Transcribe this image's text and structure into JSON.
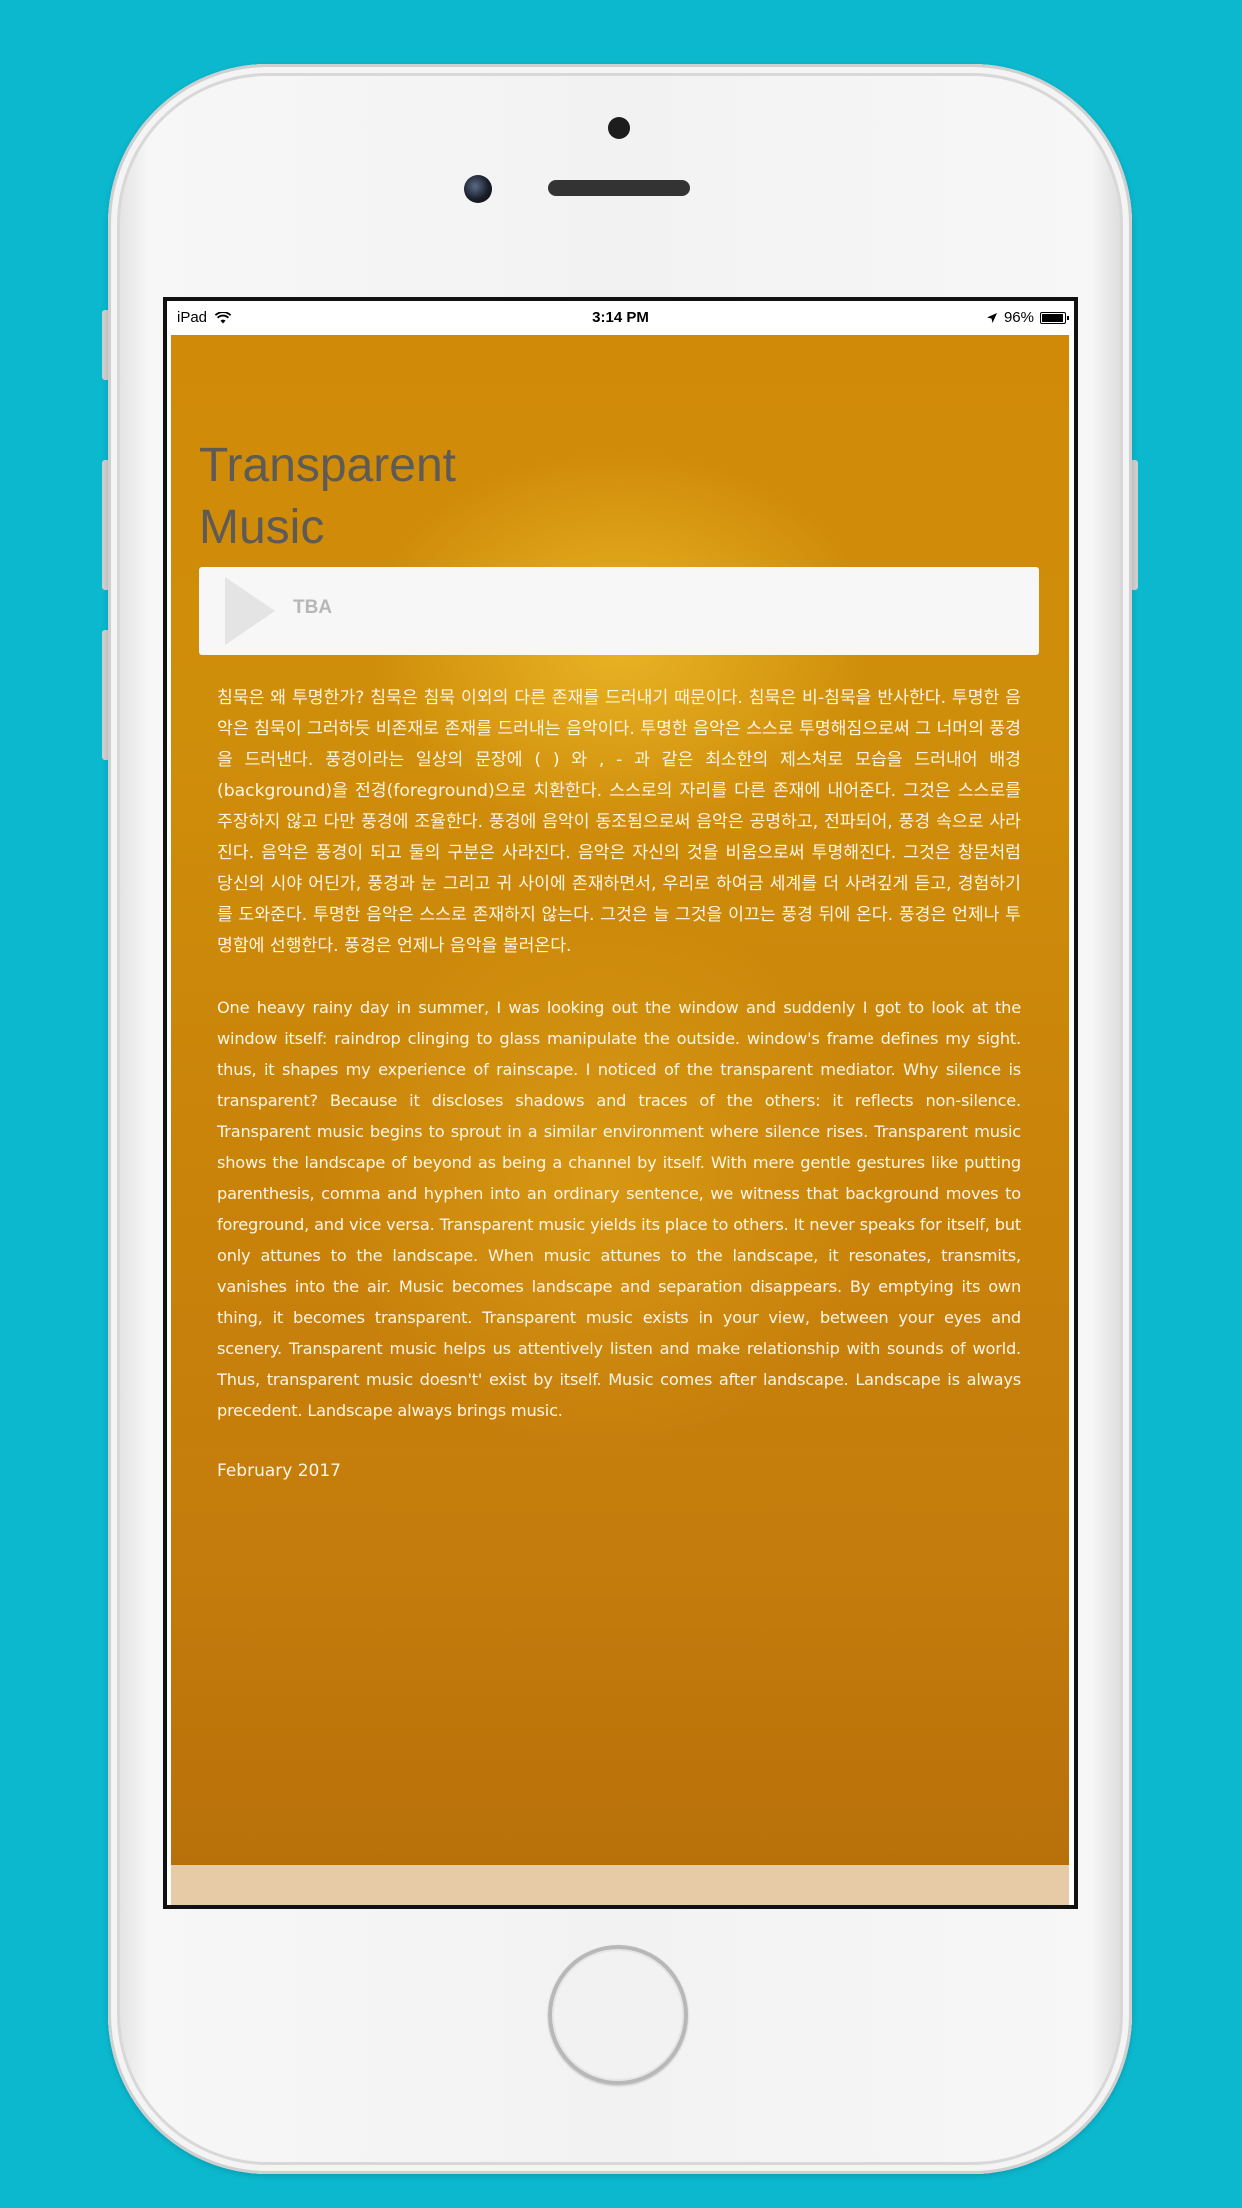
{
  "status_bar": {
    "device": "iPad",
    "time": "3:14 PM",
    "battery": "96%"
  },
  "page": {
    "title": "Transparent\nMusic"
  },
  "player": {
    "track": "TBA"
  },
  "body": {
    "korean": "침묵은 왜 투명한가? 침묵은 침묵 이외의 다른 존재를 드러내기 때문이다. 침묵은 비-침묵을 반사한다. 투명한 음악은 침묵이 그러하듯 비존재로 존재를 드러내는 음악이다. 투명한 음악은 스스로 투명해짐으로써 그 너머의 풍경을 드러낸다. 풍경이라는 일상의 문장에 ( ) 와 , - 과 같은 최소한의 제스쳐로 모습을 드러내어 배경(background)을 전경(foreground)으로 치환한다. 스스로의 자리를 다른 존재에 내어준다. 그것은 스스로를 주장하지 않고 다만 풍경에 조율한다. 풍경에 음악이 동조됨으로써 음악은 공명하고, 전파되어, 풍경 속으로 사라진다. 음악은 풍경이 되고 둘의 구분은 사라진다. 음악은 자신의 것을 비움으로써 투명해진다. 그것은 창문처럼 당신의 시야 어딘가, 풍경과 눈 그리고 귀 사이에 존재하면서, 우리로 하여금 세계를 더 사려깊게 듣고, 경험하기를 도와준다. 투명한 음악은 스스로 존재하지 않는다. 그것은 늘 그것을 이끄는 풍경 뒤에 온다. 풍경은 언제나 투명함에 선행한다. 풍경은 언제나 음악을 불러온다.",
    "english": "One heavy rainy day in summer, I was looking out the window and suddenly I got to look at the window itself: raindrop clinging to glass manipulate the outside. window's frame defines my sight. thus, it shapes my experience of rainscape. I noticed of the transparent mediator. Why silence is transparent? Because it discloses shadows and traces of the others: it reflects non-silence. Transparent music begins to sprout in a similar environment where silence rises.       Transparent music shows the landscape of beyond as being a channel by itself. With mere gentle gestures like putting parenthesis, comma and hyphen into an ordinary sentence, we  witness that background moves to foreground, and vice versa. Transparent music yields its place to others. It never speaks for itself, but only attunes to the landscape. When music attunes to the landscape, it resonates, transmits, vanishes into the air. Music becomes landscape and separation disappears. By emptying its own thing, it becomes transparent. Transparent music exists in your view, between your eyes and scenery. Transparent music helps us attentively listen and make relationship with sounds of world.   Thus, transparent music doesn't' exist by itself. Music comes after landscape. Landscape is always precedent. Landscape always brings music.",
    "date": "February 2017"
  },
  "colors": {
    "background": "#0bb8ce",
    "content_bg": "#cc880a",
    "title": "#5e5a55",
    "body_text": "#fff5e4"
  },
  "icons": {
    "wifi": "wifi-icon",
    "location": "location-arrow-icon",
    "battery": "battery-icon",
    "play": "play-icon"
  }
}
